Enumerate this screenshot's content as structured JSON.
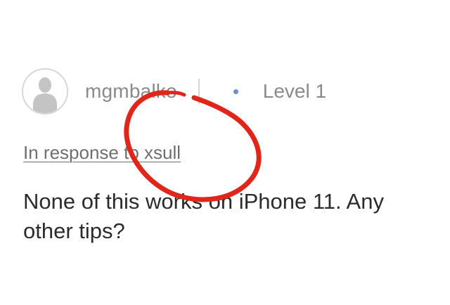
{
  "post": {
    "author": {
      "avatar_icon": "default-user-icon",
      "username": "mgmbalko",
      "level": "Level 1",
      "level_dot_color": "#6f8fcc"
    },
    "in_response_to": "In response to xsull",
    "message": "None of this works on iPhone 11. Any other tips?"
  },
  "annotation": {
    "shape": "hand-drawn circle",
    "color": "#e0251b"
  }
}
